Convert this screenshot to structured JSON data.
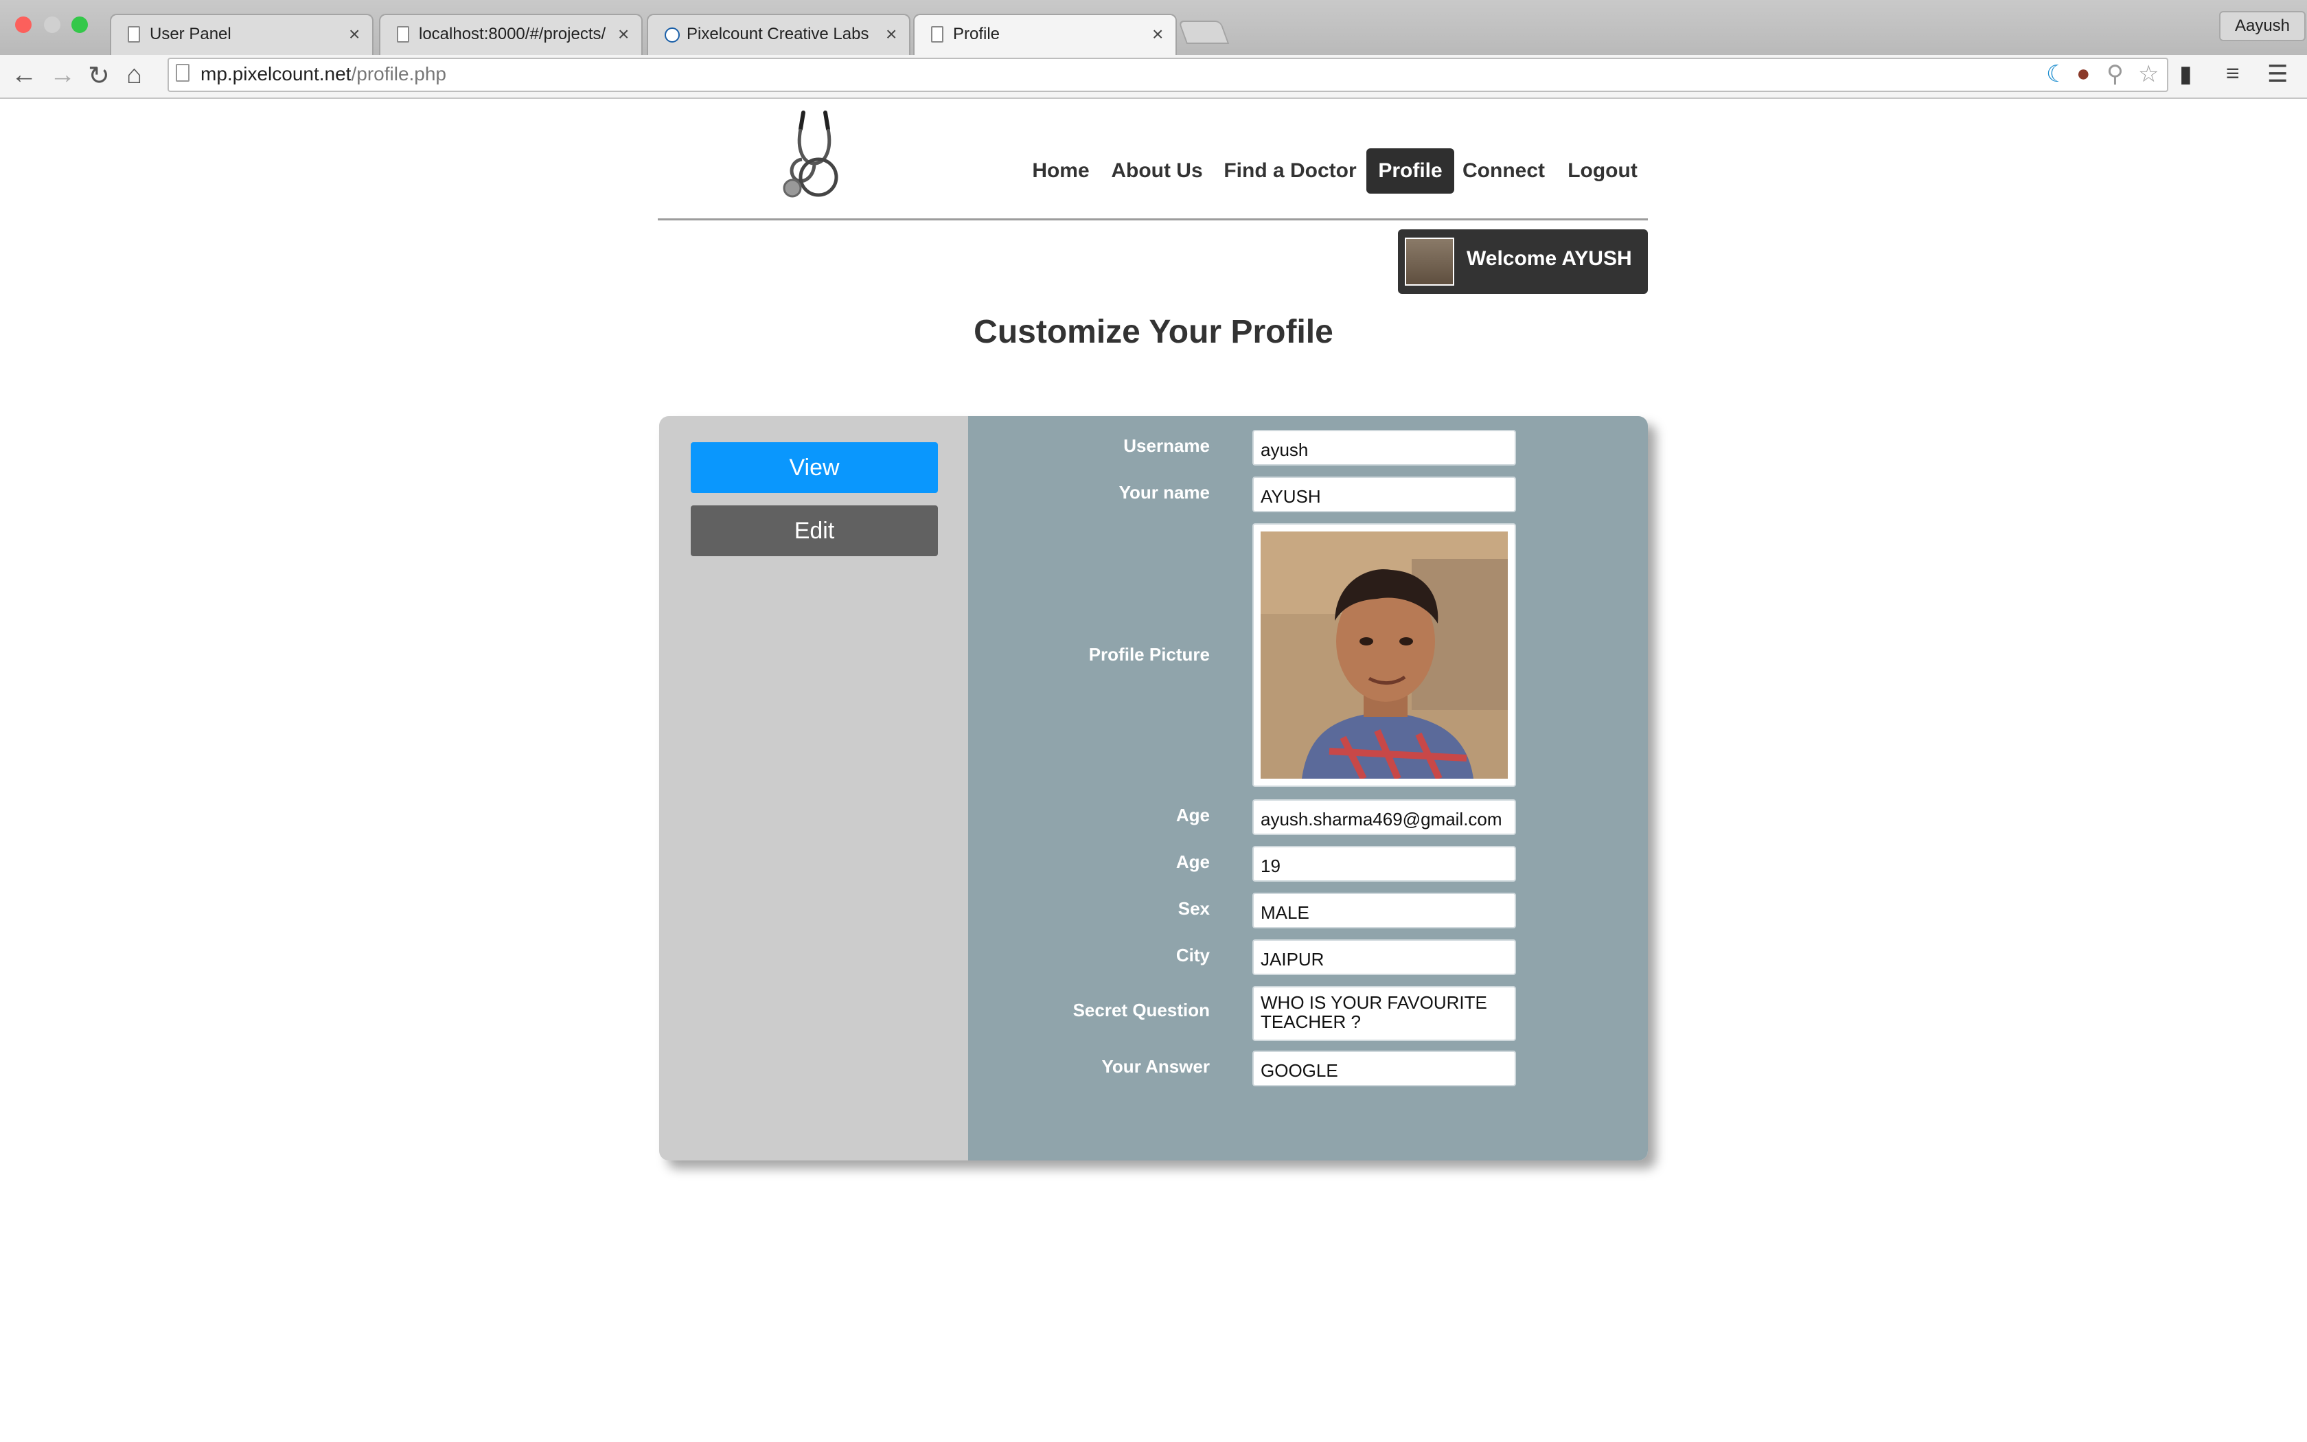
{
  "browser": {
    "tabs": [
      {
        "title": "User Panel",
        "active": false
      },
      {
        "title": "localhost:8000/#/projects/",
        "active": false
      },
      {
        "title": "Pixelcount Creative Labs | ",
        "active": false
      },
      {
        "title": "Profile",
        "active": true
      }
    ],
    "profile_name": "Aayush",
    "url_host": "mp.pixelcount.net",
    "url_path": "/profile.php"
  },
  "nav": {
    "items": [
      "Home",
      "About Us",
      "Find a Doctor",
      "Profile",
      "Connect",
      "Logout"
    ],
    "active": "Profile"
  },
  "welcome": "Welcome AYUSH",
  "heading": "Customize Your Profile",
  "sidebar": {
    "view": "View",
    "edit": "Edit"
  },
  "form": {
    "username": {
      "label": "Username",
      "value": "ayush"
    },
    "name": {
      "label": "Your name",
      "value": "AYUSH"
    },
    "picture": {
      "label": "Profile Picture"
    },
    "email": {
      "label": "Age",
      "value": "ayush.sharma469@gmail.com"
    },
    "age": {
      "label": "Age",
      "value": "19"
    },
    "sex": {
      "label": "Sex",
      "value": "MALE"
    },
    "city": {
      "label": "City",
      "value": "JAIPUR"
    },
    "secret_question": {
      "label": "Secret Question",
      "value": "WHO IS YOUR FAVOURITE TEACHER ?"
    },
    "answer": {
      "label": "Your Answer",
      "value": "GOOGLE"
    }
  },
  "colors": {
    "view_button": "#0a97fd",
    "edit_button": "#616161",
    "panel_right": "#90a4ab",
    "panel_left": "#cccccc",
    "nav_active": "#2f2f2f"
  }
}
